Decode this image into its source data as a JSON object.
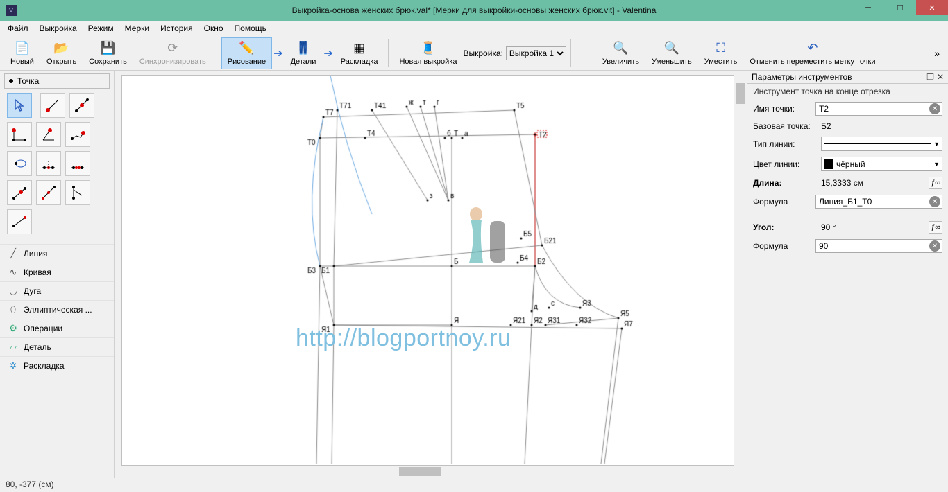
{
  "window": {
    "title": "Выкройка-основа женских брюк.val* [Мерки для выкройки-основы женских брюк.vit] - Valentina"
  },
  "menu": {
    "file": "Файл",
    "pattern": "Выкройка",
    "mode": "Режим",
    "measurements": "Мерки",
    "history": "История",
    "window": "Окно",
    "help": "Помощь"
  },
  "toolbar": {
    "new": "Новый",
    "open": "Открыть",
    "save": "Сохранить",
    "sync": "Синхронизировать",
    "draw": "Рисование",
    "details": "Детали",
    "layout": "Раскладка",
    "newpattern": "Новая выкройка",
    "patternlabel": "Выкройка:",
    "patternsel": "Выкройка 1",
    "zoomin": "Увеличить",
    "zoomout": "Уменьшить",
    "zoomfit": "Уместить",
    "undo": "Отменить переместить метку точки"
  },
  "tools": {
    "header": "Точка",
    "cats": {
      "line": "Линия",
      "curve": "Кривая",
      "arc": "Дуга",
      "ellipse": "Эллиптическая ...",
      "ops": "Операции",
      "detail": "Деталь",
      "layout": "Раскладка"
    }
  },
  "props": {
    "panel_title": "Параметры инструментов",
    "tool_name": "Инструмент точка на конце отрезка",
    "name_label": "Имя точки:",
    "name_value": "Т2",
    "base_label": "Базовая точка:",
    "base_value": "Б2",
    "linetype_label": "Тип линии:",
    "linecolor_label": "Цвет линии:",
    "linecolor_value": "чёрный",
    "length_label": "Длина:",
    "length_value": "15,3333 см",
    "formula_label": "Формула",
    "formula_value": "Линия_Б1_Т0",
    "angle_label": "Угол:",
    "angle_value": "90 °",
    "angle_formula": "90"
  },
  "status": {
    "coords": "80, -377 (см)"
  },
  "watermark": "http://blogportnoy.ru",
  "pts": {
    "T7": "Т7",
    "T71": "Т71",
    "T41": "Т41",
    "zh": "ж",
    "t": "т",
    "g": "г",
    "T5": "Т5",
    "T0": "Т0",
    "T4": "Т4",
    "b": "б",
    "T": "Т",
    "a": "а",
    "T2": "Т2",
    "z": "з",
    "v": "в",
    "B5": "Б5",
    "B21": "Б21",
    "B3": "Б3",
    "B1": "Б1",
    "B": "Б",
    "B4": "Б4",
    "B2": "Б2",
    "d": "д",
    "c": "с",
    "Ya3": "Я3",
    "Ya1": "Я1",
    "Ya": "Я",
    "Ya21": "Я21",
    "Ya2": "Я2",
    "Ya31": "Я31",
    "Ya32": "Я32",
    "Ya5": "Я5",
    "Ya7": "Я7"
  }
}
